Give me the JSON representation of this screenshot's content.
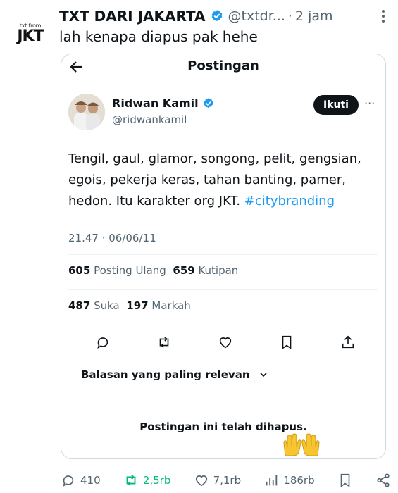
{
  "account_avatar": {
    "top_text": "txt from",
    "bottom_text": "JKT"
  },
  "header": {
    "display_name": "TXT DARI JAKARTA",
    "handle": "@txtdr...",
    "dot": "·",
    "time": "2 jam",
    "more_icon": "more-vertical-icon"
  },
  "tweet": {
    "text": "lah kenapa diapus pak hehe"
  },
  "quoted_post": {
    "page_title": "Postingan",
    "author_name": "Ridwan Kamil",
    "author_handle": "@ridwankamil",
    "follow_label": "Ikuti",
    "more": "···",
    "body": "Tengil, gaul, glamor, songong, pelit, gengsian, egois, pekerja keras, tahan banting, pamer, hedon. Itu karakter org JKT.",
    "hashtag": "#citybranding",
    "timestamp": "21.47 · 06/06/11",
    "reposts_count": "605",
    "reposts_label": "Posting Ulang",
    "quotes_count": "659",
    "quotes_label": "Kutipan",
    "likes_count": "487",
    "likes_label": "Suka",
    "bookmarks_count": "197",
    "bookmarks_label": "Markah",
    "sort_label": "Balasan yang paling relevan",
    "deleted_notice": "Postingan ini telah dihapus."
  },
  "bottom_actions": {
    "replies": "410",
    "reposts": "2,5rb",
    "likes": "7,1rb",
    "views": "186rb"
  },
  "colors": {
    "verified": "#1d9bf0",
    "repost_green": "#00ba7c",
    "hashtag": "#1d9bf0",
    "text_secondary": "#536471"
  }
}
